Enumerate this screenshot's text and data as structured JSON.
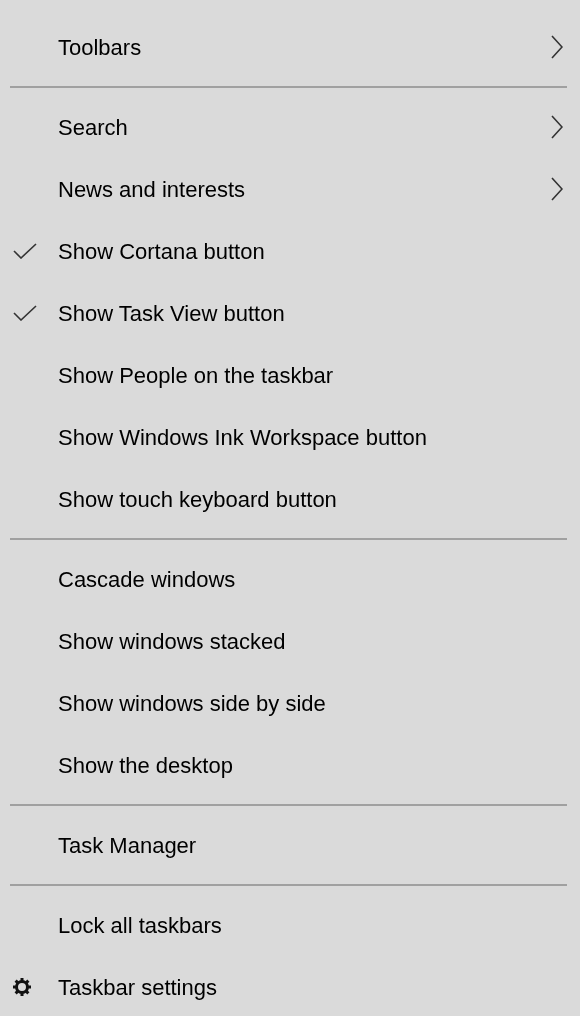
{
  "menu": {
    "items": [
      {
        "kind": "item",
        "label": "Toolbars",
        "checked": false,
        "submenu": true
      },
      {
        "kind": "separator"
      },
      {
        "kind": "item",
        "label": "Search",
        "checked": false,
        "submenu": true
      },
      {
        "kind": "item",
        "label": "News and interests",
        "checked": false,
        "submenu": true
      },
      {
        "kind": "item",
        "label": "Show Cortana button",
        "checked": true,
        "submenu": false
      },
      {
        "kind": "item",
        "label": "Show Task View button",
        "checked": true,
        "submenu": false
      },
      {
        "kind": "item",
        "label": "Show People on the taskbar",
        "checked": false,
        "submenu": false
      },
      {
        "kind": "item",
        "label": "Show Windows Ink Workspace button",
        "checked": false,
        "submenu": false
      },
      {
        "kind": "item",
        "label": "Show touch keyboard button",
        "checked": false,
        "submenu": false
      },
      {
        "kind": "separator"
      },
      {
        "kind": "item",
        "label": "Cascade windows",
        "checked": false,
        "submenu": false
      },
      {
        "kind": "item",
        "label": "Show windows stacked",
        "checked": false,
        "submenu": false
      },
      {
        "kind": "item",
        "label": "Show windows side by side",
        "checked": false,
        "submenu": false
      },
      {
        "kind": "item",
        "label": "Show the desktop",
        "checked": false,
        "submenu": false
      },
      {
        "kind": "separator"
      },
      {
        "kind": "item",
        "label": "Task Manager",
        "checked": false,
        "submenu": false
      },
      {
        "kind": "separator"
      },
      {
        "kind": "item",
        "label": "Lock all taskbars",
        "checked": false,
        "submenu": false
      },
      {
        "kind": "settings",
        "label": "Taskbar settings",
        "checked": false,
        "submenu": false
      }
    ]
  }
}
